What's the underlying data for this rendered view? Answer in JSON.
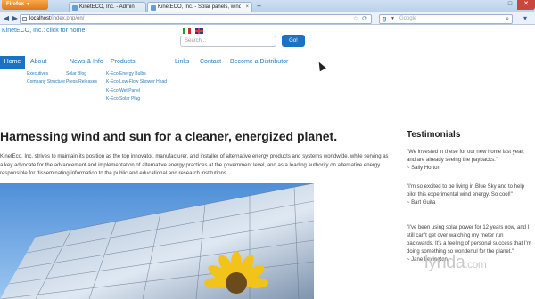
{
  "browser": {
    "menu_button": "Firefox",
    "tabs": [
      {
        "label": "KinetECO, Inc. - Administration"
      },
      {
        "label": "KinetECO, Inc. - Solar panels, windmil..."
      }
    ],
    "new_tab": "+",
    "url": {
      "host": "localhost",
      "path": "/index.php/en/"
    },
    "search_engine": "Google",
    "window_controls": {
      "minimize": "–",
      "maximize": "□",
      "close": "✕"
    },
    "icons": {
      "back": "◀",
      "forward": "▶",
      "star": "☆",
      "reload": "⟳",
      "search": "🔍",
      "bookmarks": "▾"
    }
  },
  "site": {
    "top_link": "KinetECO, Inc.: click for home",
    "search_placeholder": "Search...",
    "go_label": "Go!",
    "menu": [
      {
        "label": "Home"
      },
      {
        "label": "About"
      },
      {
        "label": "News & Info"
      },
      {
        "label": "Products"
      },
      {
        "label": "Links"
      },
      {
        "label": "Contact"
      },
      {
        "label": "Become a Distributor"
      }
    ],
    "about_submenu": [
      "Executives",
      "Company Structure"
    ],
    "news_submenu": [
      "Solar Blog",
      "Press Releases"
    ],
    "products_submenu": [
      "K-Eco Energy Bulbs",
      "K-Eco Low-Flow Shower Head",
      "K-Eco Wet Panel",
      "K-Eco Solar Plug"
    ],
    "headline": "Harnessing wind and sun for a cleaner, energized planet.",
    "intro": "KinetEco, Inc. strives to maintain its position as the top innovator, manufacturer, and installer of alternative energy products and systems worldwide, while serving as a key advocate for the advancement and implementation of alternative energy practices at the government level, and as a leading authority on alternative energy responsible for disseminating information to the public and educational and research institutions.",
    "testimonials_title": "Testimonials",
    "testimonials": [
      {
        "quote": "\"We invested in these for our new home last year, and are already seeing the paybacks.\"",
        "author": "~ Sally Horton"
      },
      {
        "quote": "\"I'm so excited to be living in Blue Sky and to help pilot this experimental wind energy. So cool!\"",
        "author": "~ Bart Guita"
      },
      {
        "quote": "\"I've been using solar power for 12 years now, and I still can't get over watching my meter run backwards. It's a feeling of personal success that I'm doing something so wonderful for the planet.\"",
        "author": "~ Jane Levington"
      }
    ]
  },
  "watermark": {
    "brand": "lynda",
    "suffix": ".com"
  },
  "colors": {
    "accent": "#1a72c5",
    "link": "#2a7dbd",
    "firefox_orange": "#e0781b"
  }
}
